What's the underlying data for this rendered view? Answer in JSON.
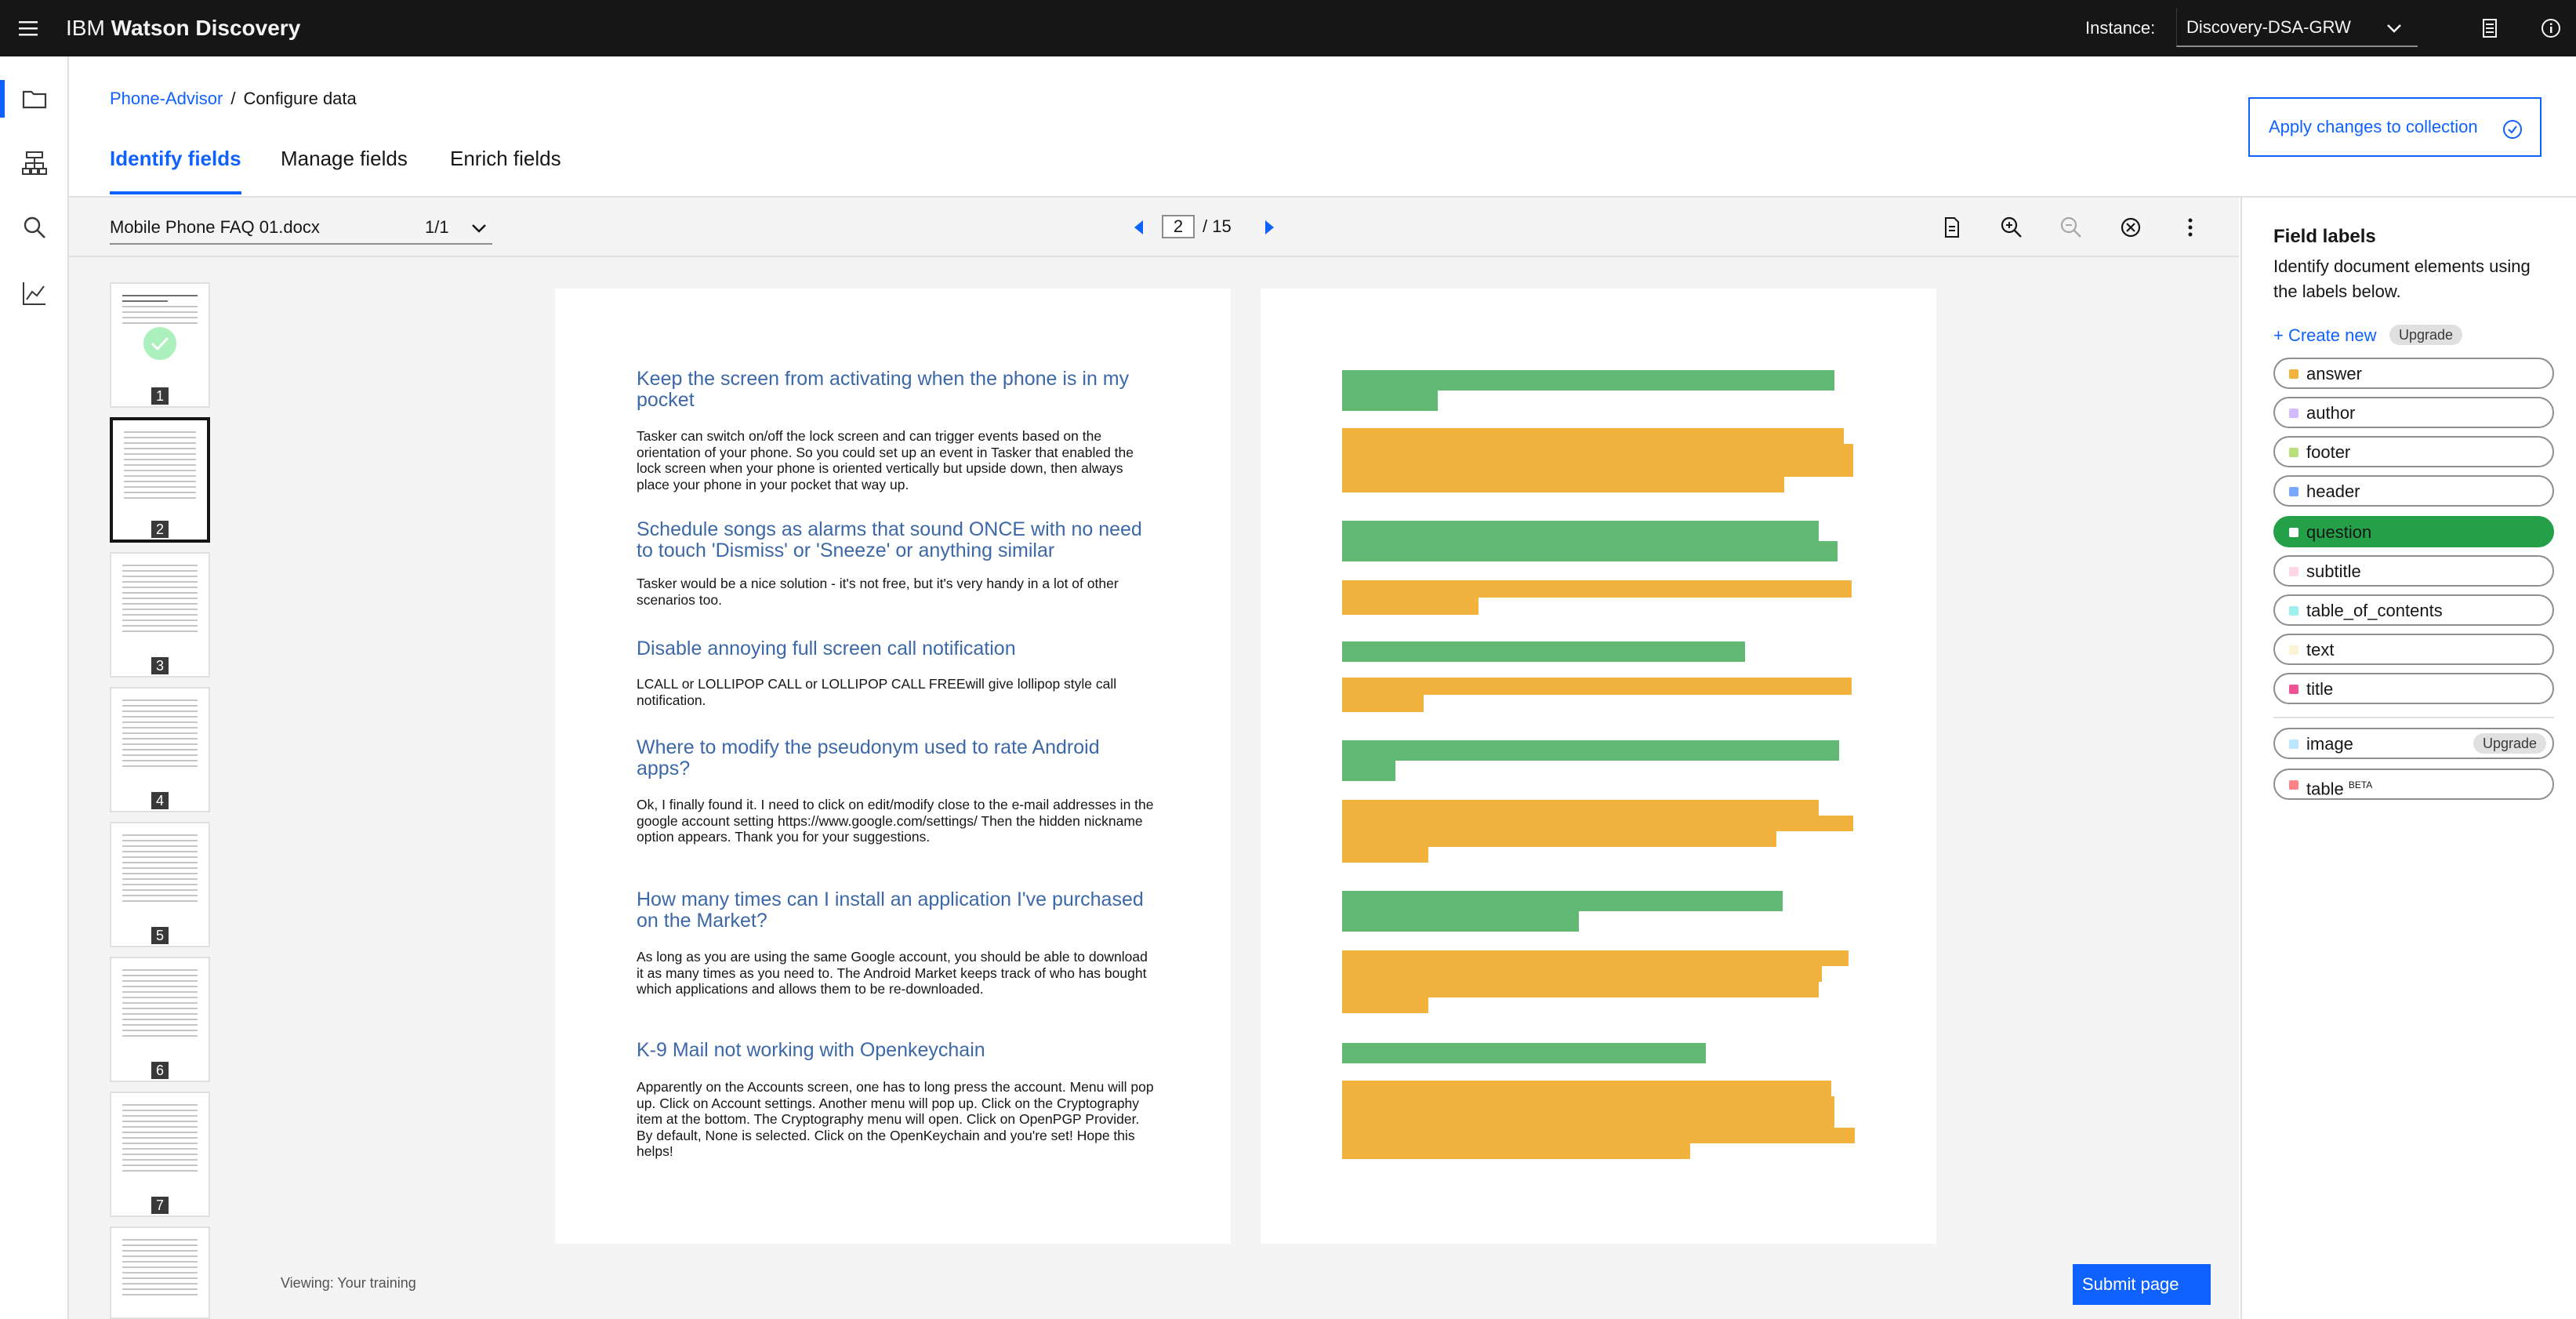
{
  "app": {
    "title_prefix": "IBM",
    "title_product": "Watson Discovery",
    "instance_label": "Instance:",
    "instance_value": "Discovery-DSA-GRW"
  },
  "breadcrumb": {
    "project": "Phone-Advisor",
    "separator": "/",
    "current": "Configure data"
  },
  "tabs": [
    "Identify fields",
    "Manage fields",
    "Enrich fields"
  ],
  "apply_button": "Apply changes to collection",
  "document": {
    "name": "Mobile Phone FAQ 01.docx",
    "part": "1/1",
    "page_current": "2",
    "page_total": "/ 15"
  },
  "thumbnails": [
    "1",
    "2",
    "3",
    "4",
    "5",
    "6",
    "7"
  ],
  "content": [
    {
      "q": "Keep the screen from activating when the phone is in my pocket",
      "a": "Tasker can switch on/off the lock screen and can trigger events based on the orientation of your phone. So you could set up an event in Tasker that enabled the lock screen when your phone is oriented vertically but upside down, then always place your phone in your pocket that way up."
    },
    {
      "q": "Schedule songs as alarms that sound ONCE with no need to touch 'Dismiss' or 'Sneeze' or anything similar",
      "a": "Tasker would be a nice solution - it's not free, but it's very handy in a lot of other scenarios too."
    },
    {
      "q": "Disable annoying full screen call notification",
      "a": "LCALL or LOLLIPOP CALL or LOLLIPOP CALL FREEwill give lollipop style call notification."
    },
    {
      "q": "Where to modify the pseudonym used to rate Android apps?",
      "a": "Ok, I finally found it. I need to click on edit/modify close to the e-mail addresses in the google account setting https://www.google.com/settings/ Then the hidden nickname option appears. Thank you for your suggestions."
    },
    {
      "q": "How many times can I install an application I've purchased on the Market?",
      "a": "As long as you are using the same Google account, you should be able to download it as many times as you need to. The Android Market keeps track of who has bought which applications and allows them to be re-downloaded."
    },
    {
      "q": "K-9 Mail not working with Openkeychain",
      "a": "Apparently on the Accounts screen, one has to long press the account. Menu will pop up. Click on Account settings. Another menu will pop up. Click on the Cryptography item at the bottom. The Cryptography menu will open. Click on OpenPGP Provider. By default, None is selected. Click on the OpenKeychain and you're set! Hope this helps!"
    }
  ],
  "label_colors": {
    "question": "#62b974",
    "answer": "#f2b23e"
  },
  "footer": {
    "viewing": "Viewing: Your training",
    "submit": "Submit page"
  },
  "panel": {
    "title": "Field labels",
    "description": "Identify document elements using the labels below.",
    "create_new": "+ Create new",
    "upgrade": "Upgrade",
    "labels": [
      {
        "name": "answer",
        "color": "#f2b23e"
      },
      {
        "name": "author",
        "color": "#d4bbff"
      },
      {
        "name": "footer",
        "color": "#b8e07c"
      },
      {
        "name": "header",
        "color": "#78a9ff"
      },
      {
        "name": "question",
        "color": "#ffffff",
        "selected": true
      },
      {
        "name": "subtitle",
        "color": "#ffd6e8"
      },
      {
        "name": "table_of_contents",
        "color": "#9ef0f0"
      },
      {
        "name": "text",
        "color": "#fcf4d6"
      },
      {
        "name": "title",
        "color": "#ee5396"
      }
    ],
    "extra_labels": [
      {
        "name": "image",
        "color": "#bae6ff",
        "tag": "Upgrade"
      },
      {
        "name": "table",
        "color": "#ff8389",
        "tag": "BETA"
      }
    ]
  }
}
